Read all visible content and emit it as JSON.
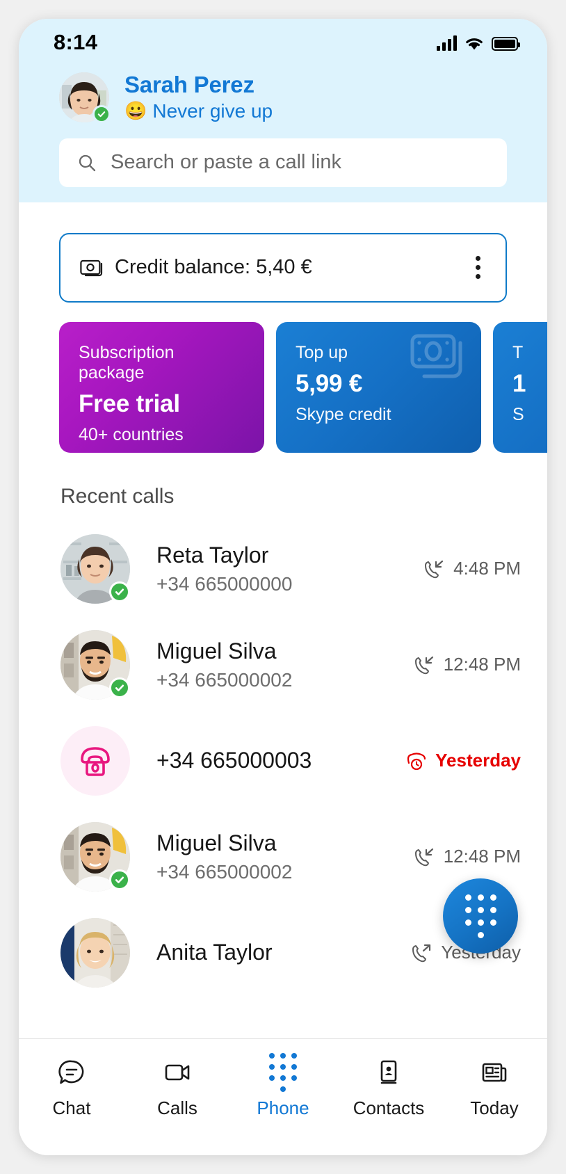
{
  "status_bar": {
    "time": "8:14",
    "signal_icon": "cellular-signal-icon",
    "wifi_icon": "wifi-icon",
    "battery_icon": "battery-full-icon"
  },
  "profile": {
    "name": "Sarah Perez",
    "mood_emoji": "😀",
    "mood_text": "Never give up",
    "presence": "online",
    "avatar_name": "sarah-perez-avatar"
  },
  "search": {
    "placeholder": "Search or paste a call link",
    "icon": "search-icon"
  },
  "credit": {
    "icon": "banknote-icon",
    "label": "Credit balance: 5,40 €",
    "menu_icon": "more-vertical-icon"
  },
  "promos": [
    {
      "top": "Subscription package",
      "mid": "Free trial",
      "bottom": "40+ countries",
      "theme": "purple",
      "color": "#a817c0",
      "watermark": false
    },
    {
      "top": "Top up",
      "mid": "5,99 €",
      "bottom": "Skype credit",
      "theme": "blue",
      "color": "#1570c5",
      "watermark": true
    },
    {
      "top": "T",
      "mid": "1",
      "bottom": "S",
      "theme": "blue",
      "color": "#1570c5",
      "watermark": false
    }
  ],
  "recent_calls": {
    "title": "Recent calls",
    "items": [
      {
        "name": "Reta Taylor",
        "number": "+34 665000000",
        "time": "4:48 PM",
        "direction": "incoming",
        "direction_icon": "call-incoming-icon",
        "presence": "online",
        "avatar_type": "photo",
        "avatar_name": "reta-taylor-avatar",
        "missed": false
      },
      {
        "name": "Miguel Silva",
        "number": "+34 665000002",
        "time": "12:48 PM",
        "direction": "incoming",
        "direction_icon": "call-incoming-icon",
        "presence": "online",
        "avatar_type": "photo",
        "avatar_name": "miguel-silva-avatar",
        "missed": false
      },
      {
        "name": "",
        "number": "+34 665000003",
        "time": "Yesterday",
        "direction": "missed",
        "direction_icon": "call-missed-icon",
        "presence": "none",
        "avatar_type": "phone",
        "avatar_name": "phone-placeholder-avatar",
        "missed": true
      },
      {
        "name": "Miguel Silva",
        "number": "+34 665000002",
        "time": "12:48 PM",
        "direction": "incoming",
        "direction_icon": "call-incoming-icon",
        "presence": "online",
        "avatar_type": "photo",
        "avatar_name": "miguel-silva-avatar",
        "missed": false
      },
      {
        "name": "Anita Taylor",
        "number": "",
        "time": "Yesterday",
        "direction": "outgoing",
        "direction_icon": "call-outgoing-icon",
        "presence": "none",
        "avatar_type": "photo",
        "avatar_name": "anita-taylor-avatar",
        "missed": false
      }
    ]
  },
  "fab": {
    "icon": "dialpad-icon",
    "color": "#1573c4"
  },
  "tabs": [
    {
      "label": "Chat",
      "icon": "chat-bubble-icon",
      "active": false
    },
    {
      "label": "Calls",
      "icon": "video-camera-icon",
      "active": false
    },
    {
      "label": "Phone",
      "icon": "dialpad-icon",
      "active": true
    },
    {
      "label": "Contacts",
      "icon": "contact-card-icon",
      "active": false
    },
    {
      "label": "Today",
      "icon": "news-icon",
      "active": false
    }
  ],
  "theme": {
    "accent": "#1278d4",
    "header_bg": "#ddf3fd",
    "missed_red": "#e60000",
    "online_green": "#3bb24a",
    "phone_pink": "#e8177f"
  }
}
